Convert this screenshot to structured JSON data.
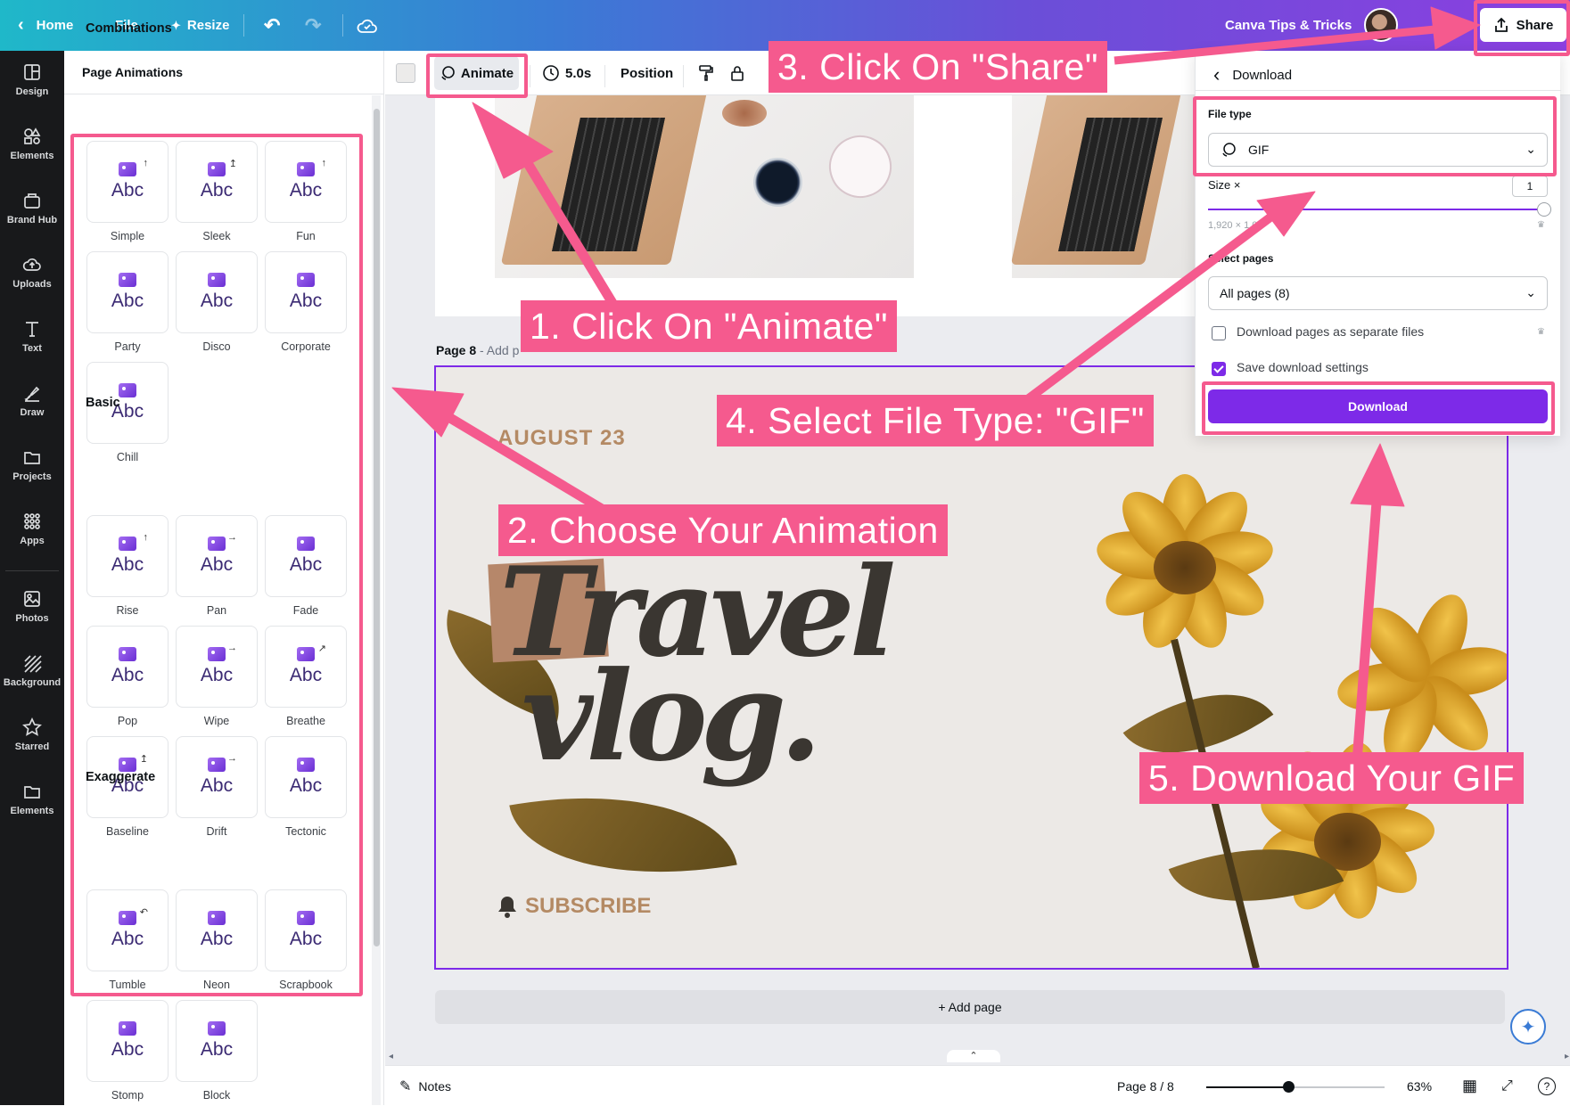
{
  "topbar": {
    "home": "Home",
    "file": "File",
    "resize": "Resize",
    "team_name": "Canva Tips & Tricks",
    "share": "Share"
  },
  "rail": [
    {
      "label": "Design",
      "icon": "design-icon"
    },
    {
      "label": "Elements",
      "icon": "elements-icon"
    },
    {
      "label": "Brand Hub",
      "icon": "brand-hub-icon"
    },
    {
      "label": "Uploads",
      "icon": "uploads-icon"
    },
    {
      "label": "Text",
      "icon": "text-icon"
    },
    {
      "label": "Draw",
      "icon": "draw-icon"
    },
    {
      "label": "Projects",
      "icon": "projects-icon"
    },
    {
      "label": "Apps",
      "icon": "apps-icon"
    },
    {
      "label": "Photos",
      "icon": "photos-icon"
    },
    {
      "label": "Background",
      "icon": "background-icon"
    },
    {
      "label": "Starred",
      "icon": "star-icon"
    },
    {
      "label": "Elements",
      "icon": "folder-icon"
    }
  ],
  "panel": {
    "title": "Page Animations",
    "sections": [
      {
        "title": "Combinations",
        "items": [
          "Simple",
          "Sleek",
          "Fun",
          "Party",
          "Disco",
          "Corporate",
          "Chill"
        ]
      },
      {
        "title": "Basic",
        "items": [
          "Rise",
          "Pan",
          "Fade",
          "Pop",
          "Wipe",
          "Breathe",
          "Baseline",
          "Drift",
          "Tectonic"
        ]
      },
      {
        "title": "Exaggerate",
        "items": [
          "Tumble",
          "Neon",
          "Scrapbook",
          "Stomp",
          "Block"
        ]
      }
    ],
    "tile_text": "Abc"
  },
  "toolbar": {
    "animate": "Animate",
    "duration": "5.0s",
    "position": "Position"
  },
  "canvas": {
    "page8_label": "Page 8",
    "page8_sub": " - Add p",
    "date": "AUGUST 23",
    "title_line1": "Travel",
    "title_line2": "vlog.",
    "subscribe": "SUBSCRIBE",
    "add_page": "+ Add page"
  },
  "bottombar": {
    "notes": "Notes",
    "page_count": "Page 8 / 8",
    "zoom": "63%",
    "zoom_level": 0.46
  },
  "download": {
    "title": "Download",
    "file_type_label": "File type",
    "file_type_value": "GIF",
    "size_label": "Size ×",
    "size_value": "1",
    "dimensions": "1,920 × 1,0",
    "pages_label": "Select pages",
    "pages_value": "All pages (8)",
    "separate_files": "Download pages as separate files",
    "save_settings": "Save download settings",
    "button": "Download"
  },
  "annotations": {
    "step1": "1. Click On \"Animate\"",
    "step2": "2. Choose Your Animation",
    "step3": "3. Click On \"Share\"",
    "step4": "4. Select File Type: \"GIF\"",
    "step5": "5. Download Your GIF"
  },
  "colors": {
    "accent": "#7d2ae8",
    "annotation": "#f55a8e",
    "rail": "#18191b"
  }
}
